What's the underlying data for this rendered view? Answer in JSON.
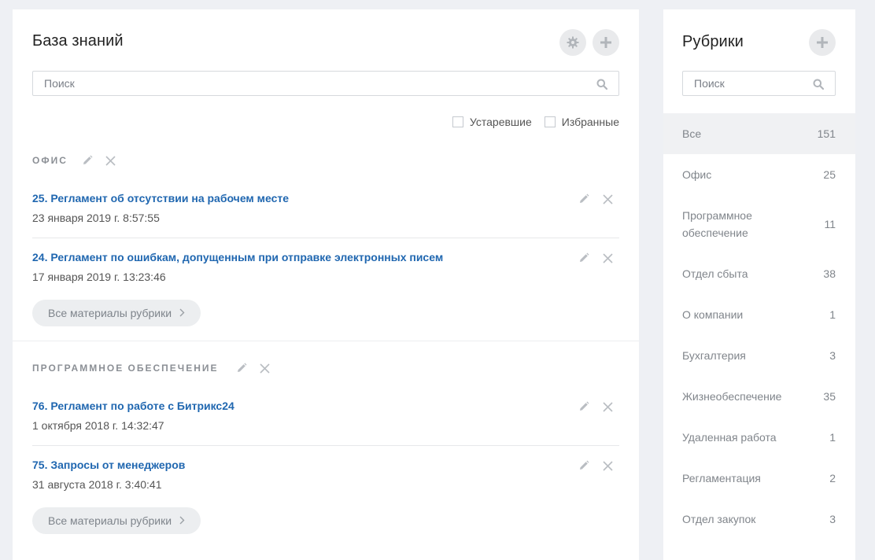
{
  "main": {
    "title": "База знаний",
    "search_placeholder": "Поиск",
    "filters": [
      {
        "label": "Устаревшие",
        "checked": false
      },
      {
        "label": "Избранные",
        "checked": false
      }
    ],
    "sections": [
      {
        "title": "ОФИС",
        "articles": [
          {
            "title": "25. Регламент об отсутствии на рабочем месте",
            "date": "23 января 2019 г. 8:57:55"
          },
          {
            "title": "24. Регламент по ошибкам, допущенным при отправке электронных писем",
            "date": "17 января 2019 г. 13:23:46"
          }
        ],
        "all_label": "Все материалы рубрики"
      },
      {
        "title": "ПРОГРАММНОЕ ОБЕСПЕЧЕНИЕ",
        "articles": [
          {
            "title": "76. Регламент по работе с Битрикс24",
            "date": "1 октября 2018 г. 14:32:47"
          },
          {
            "title": "75. Запросы от менеджеров",
            "date": "31 августа 2018 г. 3:40:41"
          }
        ],
        "all_label": "Все материалы рубрики"
      }
    ]
  },
  "sidebar": {
    "title": "Рубрики",
    "search_placeholder": "Поиск",
    "items": [
      {
        "label": "Все",
        "count": "151",
        "active": true
      },
      {
        "label": "Офис",
        "count": "25"
      },
      {
        "label": "Программное обеспечение",
        "count": "11"
      },
      {
        "label": "Отдел сбыта",
        "count": "38"
      },
      {
        "label": "О компании",
        "count": "1"
      },
      {
        "label": "Бухгалтерия",
        "count": "3"
      },
      {
        "label": "Жизнеобеспечение",
        "count": "35"
      },
      {
        "label": "Удаленная работа",
        "count": "1"
      },
      {
        "label": "Регламентация",
        "count": "2"
      },
      {
        "label": "Отдел закупок",
        "count": "3"
      }
    ]
  },
  "icons": {
    "gear": "gear-icon",
    "plus": "plus-icon",
    "search": "search-icon",
    "edit": "pencil-icon",
    "delete": "close-icon",
    "chevron": "chevron-right-icon"
  },
  "colors": {
    "link": "#2067b0",
    "background": "#eef0f4",
    "active_item": "#f0f1f3"
  }
}
